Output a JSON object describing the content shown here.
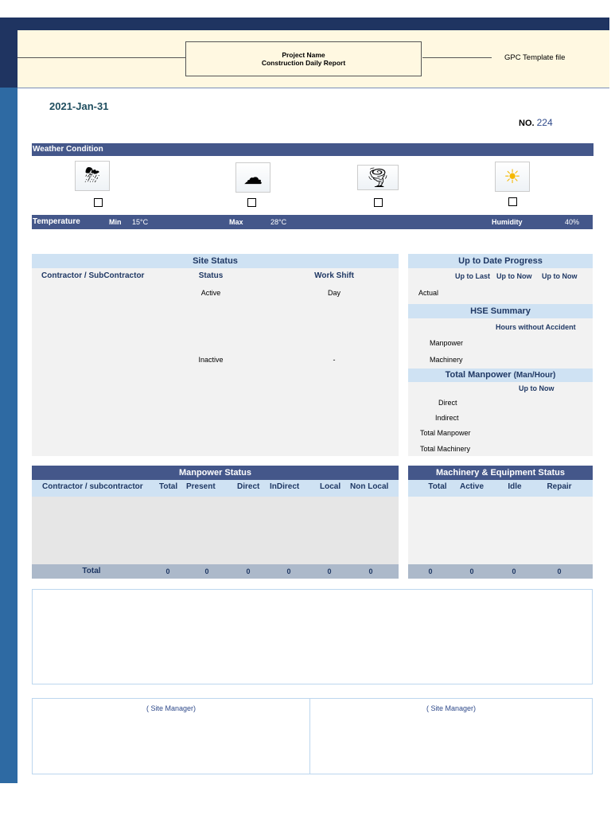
{
  "header": {
    "project_name": "Project Name",
    "report_title": "Construction Daily Report",
    "template_label": "GPC Template file"
  },
  "date": "2021-Jan-31",
  "report_no": {
    "label": "NO.",
    "value": "224"
  },
  "weather": {
    "title": "Weather Condition",
    "icons": [
      "storm-icon",
      "cloudy-icon",
      "tornado-icon",
      "sunny-icon"
    ],
    "temperature_label": "Temperature",
    "min_label": "Min",
    "min_value": "15°C",
    "max_label": "Max",
    "max_value": "28°C",
    "humidity_label": "Humidity",
    "humidity_value": "40%"
  },
  "site_status": {
    "title": "Site Status",
    "columns": [
      "Contractor / SubContractor",
      "Status",
      "Work Shift"
    ],
    "rows": [
      {
        "status": "Active",
        "shift": "Day"
      },
      {
        "status": "Inactive",
        "shift": "-"
      }
    ]
  },
  "progress": {
    "title": "Up to Date Progress",
    "columns": [
      "Up to Last",
      "Up to Now",
      "Up to Now"
    ],
    "row_label": "Actual"
  },
  "hse": {
    "title": "HSE Summary",
    "column": "Hours without Accident",
    "rows": [
      "Manpower",
      "Machinery"
    ]
  },
  "total_manpower": {
    "title": "Total Manpower",
    "unit": "(Man/Hour)",
    "column": "Up to Now",
    "rows": [
      "Direct",
      "Indirect",
      "Total Manpower",
      "Total Machinery"
    ]
  },
  "manpower_status": {
    "title": "Manpower Status",
    "columns": [
      "Contractor / subcontractor",
      "Total",
      "Present",
      "Direct",
      "InDirect",
      "Local",
      "Non Local"
    ],
    "total_label": "Total",
    "totals": [
      "0",
      "0",
      "0",
      "0",
      "0",
      "0"
    ]
  },
  "machinery_status": {
    "title": "Machinery & Equipment Status",
    "columns": [
      "Total",
      "Active",
      "Idle",
      "Repair"
    ],
    "totals": [
      "0",
      "0",
      "0",
      "0"
    ]
  },
  "signatures": [
    "( Site Manager)",
    "( Site Manager)"
  ]
}
